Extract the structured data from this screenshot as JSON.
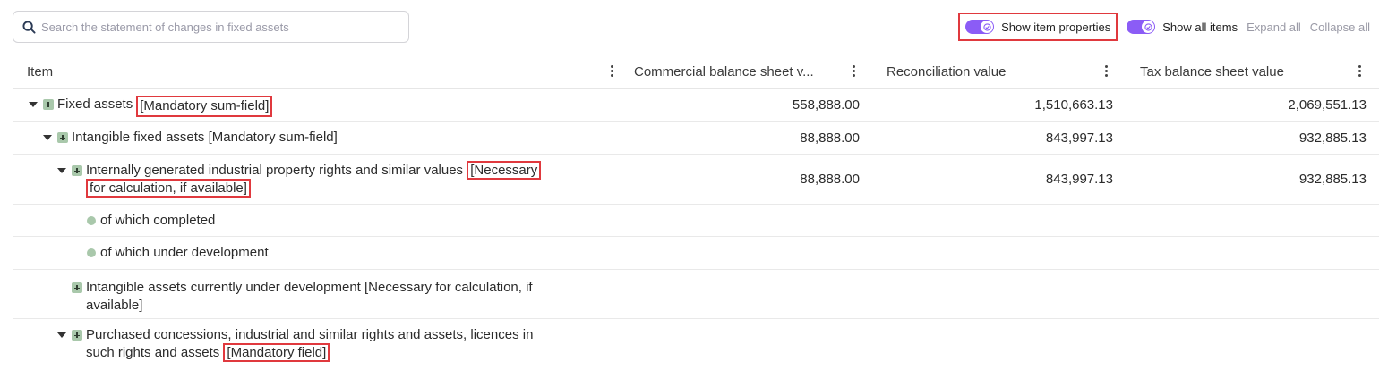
{
  "search": {
    "placeholder": "Search the statement of changes in fixed assets",
    "value": ""
  },
  "controls": {
    "show_item_properties": "Show item properties",
    "show_all_items": "Show all items",
    "expand_all": "Expand all",
    "collapse_all": "Collapse all",
    "toggle_color": "#8b5cf6",
    "highlight_color": "#e0393e"
  },
  "columns": {
    "item": "Item",
    "commercial": "Commercial balance sheet v...",
    "reconciliation": "Reconciliation value",
    "tax": "Tax balance sheet value"
  },
  "rows": [
    {
      "name": "Fixed assets",
      "tag": "[Mandatory sum-field]",
      "commercial": "558,888.00",
      "reconciliation": "1,510,663.13",
      "tax": "2,069,551.13"
    },
    {
      "name": "Intangible fixed assets [Mandatory sum-field]",
      "commercial": "88,888.00",
      "reconciliation": "843,997.13",
      "tax": "932,885.13"
    },
    {
      "name": "Internally generated industrial property rights and similar values",
      "tag_part1": "[Necessary",
      "tag_part2": "for calculation, if available]",
      "commercial": "88,888.00",
      "reconciliation": "843,997.13",
      "tax": "932,885.13"
    },
    {
      "name": "of which completed"
    },
    {
      "name": "of which under development"
    },
    {
      "name_line1": "Intangible assets currently under development [Necessary for calculation, if",
      "name_line2": "available]"
    },
    {
      "name_line1": "Purchased concessions, industrial and similar rights and assets, licences in",
      "name_line2": "such rights and assets",
      "tag": "[Mandatory field]"
    }
  ]
}
